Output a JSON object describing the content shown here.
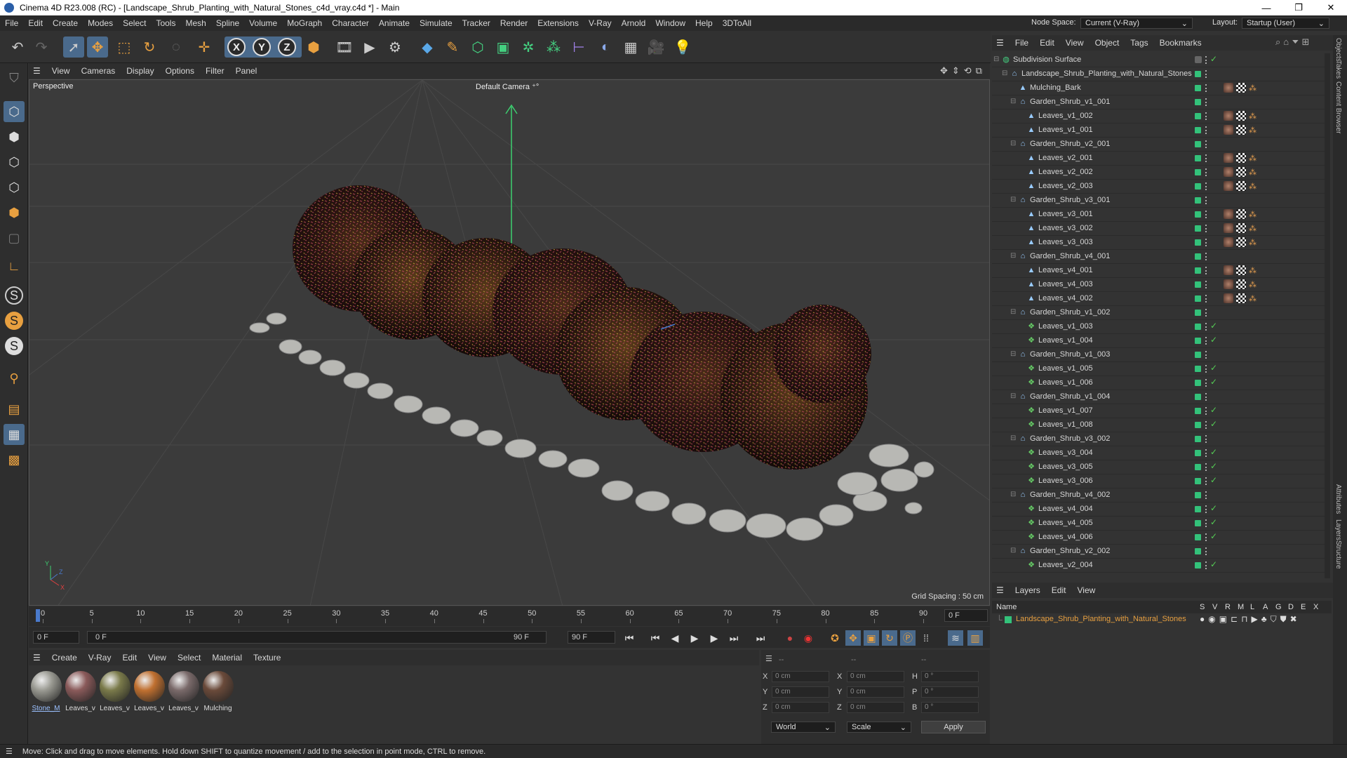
{
  "window": {
    "title": "Cinema 4D R23.008 (RC) - [Landscape_Shrub_Planting_with_Natural_Stones_c4d_vray.c4d *] - Main",
    "min": "—",
    "max": "❐",
    "close": "✕"
  },
  "menubar": {
    "items": [
      "File",
      "Edit",
      "Create",
      "Modes",
      "Select",
      "Tools",
      "Mesh",
      "Spline",
      "Volume",
      "MoGraph",
      "Character",
      "Animate",
      "Simulate",
      "Tracker",
      "Render",
      "Extensions",
      "V-Ray",
      "Arnold",
      "Window",
      "Help",
      "3DToAll"
    ],
    "node_space_label": "Node Space:",
    "node_space_value": "Current (V-Ray)",
    "layout_label": "Layout:",
    "layout_value": "Startup (User)"
  },
  "viewport": {
    "menu": [
      "View",
      "Cameras",
      "Display",
      "Options",
      "Filter",
      "Panel"
    ],
    "view_name": "Perspective",
    "camera": "Default Camera",
    "grid_spacing": "Grid Spacing : 50 cm"
  },
  "timeline": {
    "ticks": [
      "0",
      "5",
      "10",
      "15",
      "20",
      "25",
      "30",
      "35",
      "40",
      "45",
      "50",
      "55",
      "60",
      "65",
      "70",
      "75",
      "80",
      "85",
      "90"
    ],
    "end_field": "0 F",
    "start_frame": "0 F",
    "range_start": "0 F",
    "range_end": "90 F",
    "max_frame": "90 F"
  },
  "materials": {
    "menu": [
      "Create",
      "V-Ray",
      "Edit",
      "View",
      "Select",
      "Material",
      "Texture"
    ],
    "items": [
      {
        "label": "Stone_M",
        "color": "#9a9a92"
      },
      {
        "label": "Leaves_v",
        "color": "#8a5a5a"
      },
      {
        "label": "Leaves_v",
        "color": "#7a7a4a"
      },
      {
        "label": "Leaves_v",
        "color": "#c07030"
      },
      {
        "label": "Leaves_v",
        "color": "#7a6a6a"
      },
      {
        "label": "Mulching",
        "color": "#6a4a3a"
      }
    ]
  },
  "coords": {
    "header": [
      "--",
      "--",
      "--"
    ],
    "rows": [
      {
        "a": "X",
        "av": "0 cm",
        "b": "X",
        "bv": "0 cm",
        "c": "H",
        "cv": "0 °"
      },
      {
        "a": "Y",
        "av": "0 cm",
        "b": "Y",
        "bv": "0 cm",
        "c": "P",
        "cv": "0 °"
      },
      {
        "a": "Z",
        "av": "0 cm",
        "b": "Z",
        "bv": "0 cm",
        "c": "B",
        "cv": "0 °"
      }
    ],
    "mode1": "World",
    "mode2": "Scale",
    "apply": "Apply"
  },
  "status": "Move: Click and drag to move elements. Hold down SHIFT to quantize movement / add to the selection in point mode, CTRL to remove.",
  "objects": {
    "menu": [
      "File",
      "Edit",
      "View",
      "Object",
      "Tags",
      "Bookmarks"
    ],
    "rows": [
      {
        "name": "Subdivision Surface",
        "level": 0,
        "kind": "subd"
      },
      {
        "name": "Landscape_Shrub_Planting_with_Natural_Stones",
        "level": 1,
        "kind": "null"
      },
      {
        "name": "Mulching_Bark",
        "level": 2,
        "kind": "mesh",
        "tags": true
      },
      {
        "name": "Garden_Shrub_v1_001",
        "level": 2,
        "kind": "null"
      },
      {
        "name": "Leaves_v1_002",
        "level": 3,
        "kind": "mesh",
        "tags": true
      },
      {
        "name": "Leaves_v1_001",
        "level": 3,
        "kind": "mesh",
        "tags": true
      },
      {
        "name": "Garden_Shrub_v2_001",
        "level": 2,
        "kind": "null"
      },
      {
        "name": "Leaves_v2_001",
        "level": 3,
        "kind": "mesh",
        "tags": true
      },
      {
        "name": "Leaves_v2_002",
        "level": 3,
        "kind": "mesh",
        "tags": true
      },
      {
        "name": "Leaves_v2_003",
        "level": 3,
        "kind": "mesh",
        "tags": true
      },
      {
        "name": "Garden_Shrub_v3_001",
        "level": 2,
        "kind": "null"
      },
      {
        "name": "Leaves_v3_001",
        "level": 3,
        "kind": "mesh",
        "tags": true
      },
      {
        "name": "Leaves_v3_002",
        "level": 3,
        "kind": "mesh",
        "tags": true
      },
      {
        "name": "Leaves_v3_003",
        "level": 3,
        "kind": "mesh",
        "tags": true
      },
      {
        "name": "Garden_Shrub_v4_001",
        "level": 2,
        "kind": "null"
      },
      {
        "name": "Leaves_v4_001",
        "level": 3,
        "kind": "mesh",
        "tags": true
      },
      {
        "name": "Leaves_v4_003",
        "level": 3,
        "kind": "mesh",
        "tags": true
      },
      {
        "name": "Leaves_v4_002",
        "level": 3,
        "kind": "mesh",
        "tags": true
      },
      {
        "name": "Garden_Shrub_v1_002",
        "level": 2,
        "kind": "null"
      },
      {
        "name": "Leaves_v1_003",
        "level": 3,
        "kind": "inst",
        "check": true
      },
      {
        "name": "Leaves_v1_004",
        "level": 3,
        "kind": "inst",
        "check": true
      },
      {
        "name": "Garden_Shrub_v1_003",
        "level": 2,
        "kind": "null"
      },
      {
        "name": "Leaves_v1_005",
        "level": 3,
        "kind": "inst",
        "check": true
      },
      {
        "name": "Leaves_v1_006",
        "level": 3,
        "kind": "inst",
        "check": true
      },
      {
        "name": "Garden_Shrub_v1_004",
        "level": 2,
        "kind": "null"
      },
      {
        "name": "Leaves_v1_007",
        "level": 3,
        "kind": "inst",
        "check": true
      },
      {
        "name": "Leaves_v1_008",
        "level": 3,
        "kind": "inst",
        "check": true
      },
      {
        "name": "Garden_Shrub_v3_002",
        "level": 2,
        "kind": "null"
      },
      {
        "name": "Leaves_v3_004",
        "level": 3,
        "kind": "inst",
        "check": true
      },
      {
        "name": "Leaves_v3_005",
        "level": 3,
        "kind": "inst",
        "check": true
      },
      {
        "name": "Leaves_v3_006",
        "level": 3,
        "kind": "inst",
        "check": true
      },
      {
        "name": "Garden_Shrub_v4_002",
        "level": 2,
        "kind": "null"
      },
      {
        "name": "Leaves_v4_004",
        "level": 3,
        "kind": "inst",
        "check": true
      },
      {
        "name": "Leaves_v4_005",
        "level": 3,
        "kind": "inst",
        "check": true
      },
      {
        "name": "Leaves_v4_006",
        "level": 3,
        "kind": "inst",
        "check": true
      },
      {
        "name": "Garden_Shrub_v2_002",
        "level": 2,
        "kind": "null"
      },
      {
        "name": "Leaves_v2_004",
        "level": 3,
        "kind": "inst",
        "check": true
      }
    ]
  },
  "layers": {
    "menu": [
      "Layers",
      "Edit",
      "View"
    ],
    "name_header": "Name",
    "cols": [
      "S",
      "V",
      "R",
      "M",
      "L",
      "A",
      "G",
      "D",
      "E",
      "X"
    ],
    "layer_name": "Landscape_Shrub_Planting_with_Natural_Stones",
    "layer_color": "#33c27a"
  },
  "side_tabs": [
    "Objects",
    "Takes",
    "Content Browser",
    "Attributes",
    "Layers",
    "Structure"
  ]
}
